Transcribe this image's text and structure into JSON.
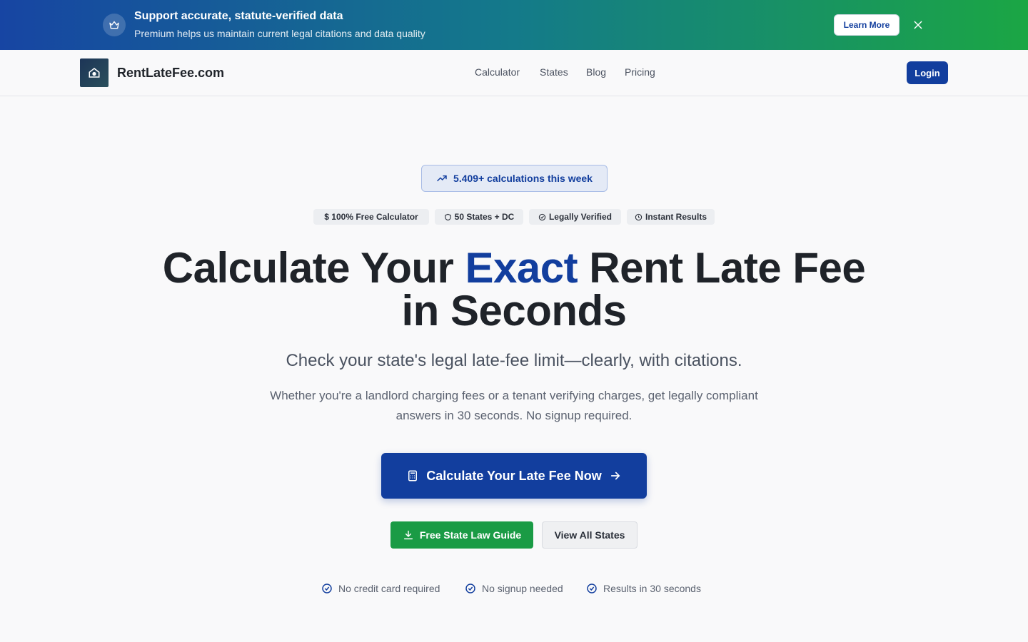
{
  "promo": {
    "title": "Support accurate, statute-verified data",
    "subtitle": "Premium helps us maintain current legal citations and data quality",
    "button": "Learn More",
    "icon": "crown-icon",
    "close_icon": "close-icon"
  },
  "header": {
    "brand": "RentLateFee.com",
    "nav": [
      "Calculator",
      "States",
      "Blog",
      "Pricing"
    ],
    "login": "Login"
  },
  "hero": {
    "stat": "5.409+ calculations this week",
    "badges": [
      "$ 100% Free Calculator",
      "50 States + DC",
      "Legally Verified",
      "Instant Results"
    ],
    "title_part1": "Calculate Your ",
    "title_accent": "Exact",
    "title_part2": " Rent Late Fee in Seconds",
    "subline": "Check your state's legal late-fee limit—clearly, with citations.",
    "description": "Whether you're a landlord charging fees or a tenant verifying charges, get legally compliant answers in 30 seconds. No signup required.",
    "cta": "Calculate Your Late Fee Now",
    "guide_button": "Free State Law Guide",
    "states_button": "View All States",
    "checks": [
      "No credit card required",
      "No signup needed",
      "Results in 30 seconds"
    ]
  },
  "colors": {
    "primary": "#123e9e",
    "green": "#1a9b45"
  }
}
